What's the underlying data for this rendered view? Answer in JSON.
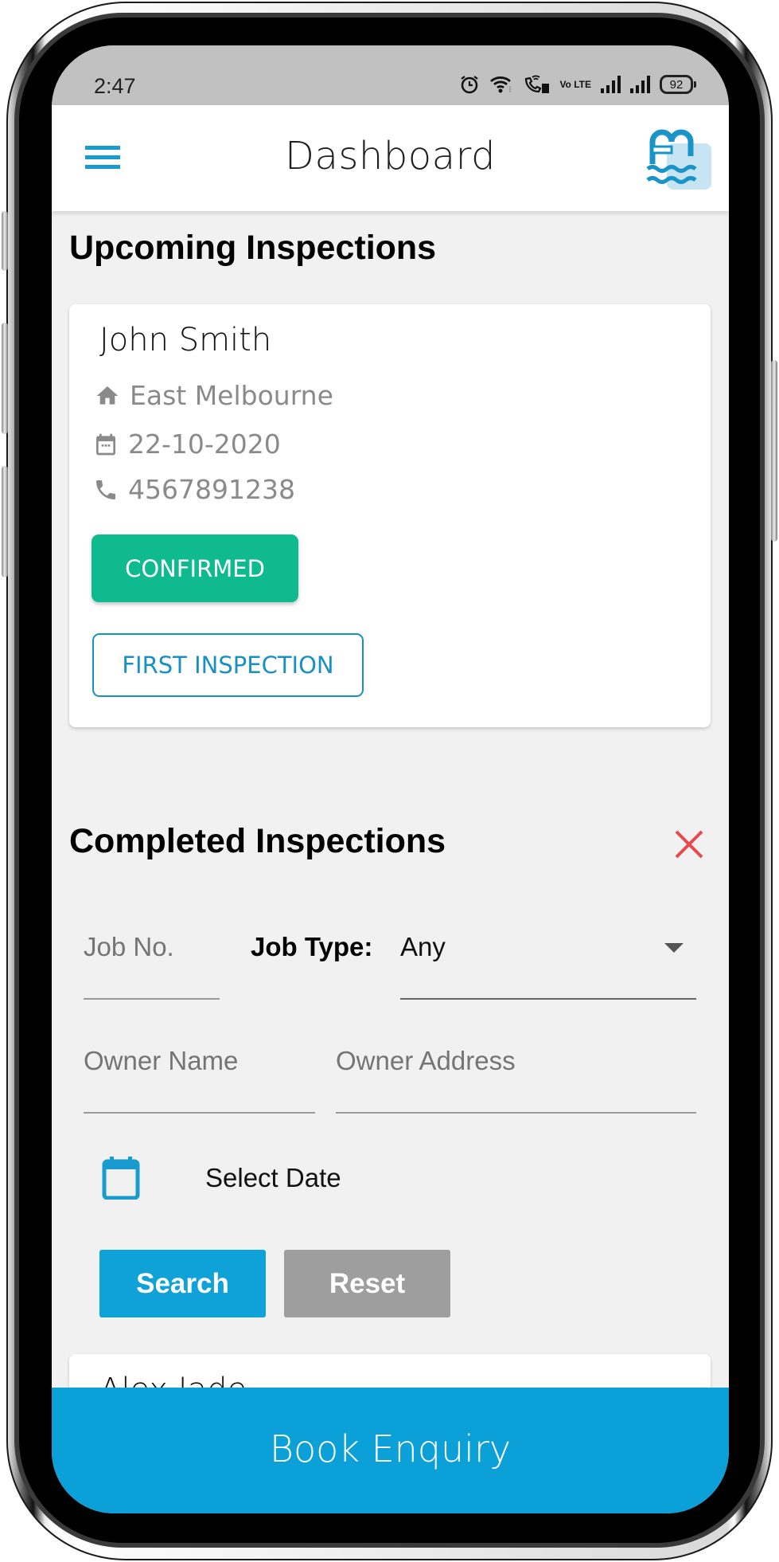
{
  "status_bar": {
    "time": "2:47",
    "battery": "92",
    "volte_label": "Vo LTE",
    "icons": [
      "alarm-icon",
      "wifi-icon",
      "wifi-calling-icon",
      "volte-icon",
      "signal-icon",
      "signal-icon",
      "battery-icon"
    ]
  },
  "app_bar": {
    "title": "Dashboard",
    "menu_icon": "hamburger-menu-icon",
    "logo_icon": "pool-ladder-logo"
  },
  "upcoming": {
    "heading": "Upcoming Inspections",
    "items": [
      {
        "name": "John Smith",
        "address": "East Melbourne",
        "date": "22-10-2020",
        "phone": "4567891238",
        "status_label": "CONFIRMED",
        "inspection_type_label": "FIRST INSPECTION"
      }
    ]
  },
  "completed": {
    "heading": "Completed Inspections",
    "close_icon": "close-icon",
    "filters": {
      "job_no_placeholder": "Job No.",
      "job_no_value": "",
      "job_type_label": "Job Type:",
      "job_type_value": "Any",
      "owner_name_placeholder": "Owner Name",
      "owner_name_value": "",
      "owner_address_placeholder": "Owner Address",
      "owner_address_value": "",
      "date_label": "Select Date"
    },
    "search_label": "Search",
    "reset_label": "Reset",
    "items": [
      {
        "name": "Alex Jade"
      }
    ]
  },
  "footer": {
    "book_label": "Book Enquiry"
  },
  "colors": {
    "primary": "#0ba0d8",
    "confirmed": "#0fba8f",
    "outline": "#1990c4",
    "reset": "#9e9e9e",
    "close": "#e5484d",
    "background": "#f1f1f1"
  }
}
